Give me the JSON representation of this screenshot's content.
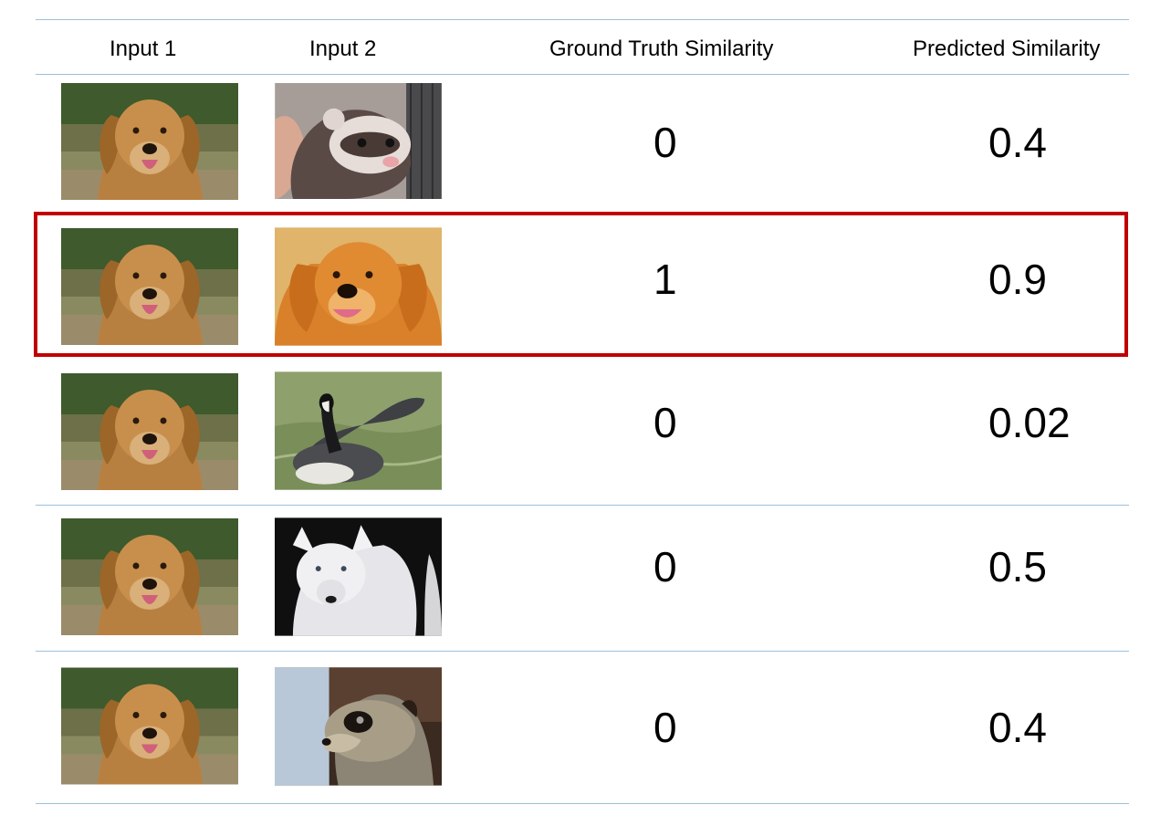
{
  "header": {
    "input1": "Input 1",
    "input2": "Input 2",
    "ground_truth": "Ground Truth Similarity",
    "predicted": "Predicted Similarity"
  },
  "rows": [
    {
      "input1": "golden-retriever",
      "input2": "ferret",
      "ground_truth": "0",
      "predicted": "0.4"
    },
    {
      "input1": "golden-retriever",
      "input2": "golden-retriever",
      "ground_truth": "1",
      "predicted": "0.9",
      "highlighted": true
    },
    {
      "input1": "golden-retriever",
      "input2": "goose",
      "ground_truth": "0",
      "predicted": "0.02"
    },
    {
      "input1": "golden-retriever",
      "input2": "white-wolf",
      "ground_truth": "0",
      "predicted": "0.5"
    },
    {
      "input1": "golden-retriever",
      "input2": "meerkat",
      "ground_truth": "0",
      "predicted": "0.4"
    }
  ],
  "colors": {
    "divider": "#9cc0dc",
    "highlight": "#c00000"
  }
}
